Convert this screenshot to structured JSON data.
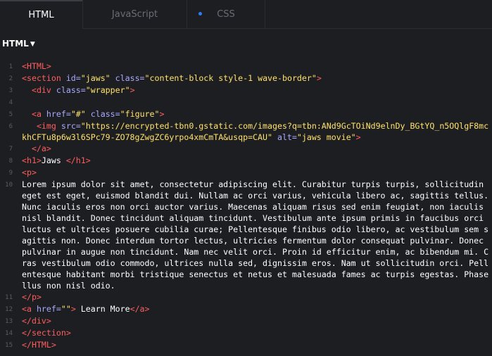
{
  "tabs": {
    "html": "HTML",
    "javascript": "JavaScript",
    "css": "CSS"
  },
  "language_selector": "HTML",
  "colors": {
    "background": "#1d1e22",
    "tag": "#ff5d5d",
    "attribute": "#a9a9ff",
    "string": "#ffe16a",
    "text": "#ffffff",
    "line_number": "#5a5c64",
    "unsaved_dot": "#2f7bf5"
  },
  "code": {
    "l1": "<HTML>",
    "l2": {
      "open": "<section",
      "a1": "id=",
      "v1": "\"jaws\"",
      "a2": "class=",
      "v2": "\"content-block style-1 wave-border\"",
      "close": ">"
    },
    "l3": {
      "open": "<div",
      "a1": "class=",
      "v1": "\"wrapper\"",
      "close": ">"
    },
    "l5": {
      "open": "<a",
      "a1": "href=",
      "v1": "\"#\"",
      "a2": "class=",
      "v2": "\"figure\"",
      "close": ">"
    },
    "l6": {
      "open": "<img",
      "a1": "src=",
      "v1": "\"https://encrypted-tbn0.gstatic.com/images?q=tbn:ANd9GcTOiNd9elnDy_BGtYQ_n5OQlgF8mckhCFTu8p6w3l6SPc79-ZO78gZwgZC6yrpo4xmCmTA&usqp=CAU\"",
      "a2": "alt=",
      "v2": "\"jaws movie\"",
      "close": ">"
    },
    "l7": "</a>",
    "l8": {
      "open": "<h1>",
      "text": "Jaws ",
      "close": "</h1>"
    },
    "l9": "<p>",
    "l10": "Lorem ipsum dolor sit amet, consectetur adipiscing elit. Curabitur turpis turpis, sollicitudin eget est eget, euismod blandit dui. Nullam ac orci varius, vehicula libero ac, sagittis tellus. Nunc iaculis eros non orci auctor varius. Maecenas aliquam risus sed enim feugiat, non iaculis nisl blandit. Donec tincidunt aliquam tincidunt. Vestibulum ante ipsum primis in faucibus orci luctus et ultrices posuere cubilia curae; Pellentesque finibus odio libero, ac vestibulum sem sagittis non. Donec interdum tortor lectus, ultricies fermentum dolor consequat pulvinar. Donec pulvinar in augue non tincidunt. Nam nec velit orci. Proin id efficitur enim, ac bibendum mi. Cras vestibulum odio commodo, ultrices nulla sed, dignissim eros. Nam ut sollicitudin orci. Pellentesque habitant morbi tristique senectus et netus et malesuada fames ac turpis egestas. Phasellus non nisl odio.",
    "l11": "</p>",
    "l12": {
      "open": "<a",
      "a1": "href=",
      "v1": "\"\"",
      "close": ">",
      "text": " Learn More",
      "end": "</a>"
    },
    "l13": "</div>",
    "l14": "</section>",
    "l15": "</HTML>"
  },
  "line_numbers": [
    "1",
    "2",
    "3",
    "4",
    "5",
    "6",
    "7",
    "8",
    "9",
    "10",
    "11",
    "12",
    "13",
    "14",
    "15"
  ]
}
